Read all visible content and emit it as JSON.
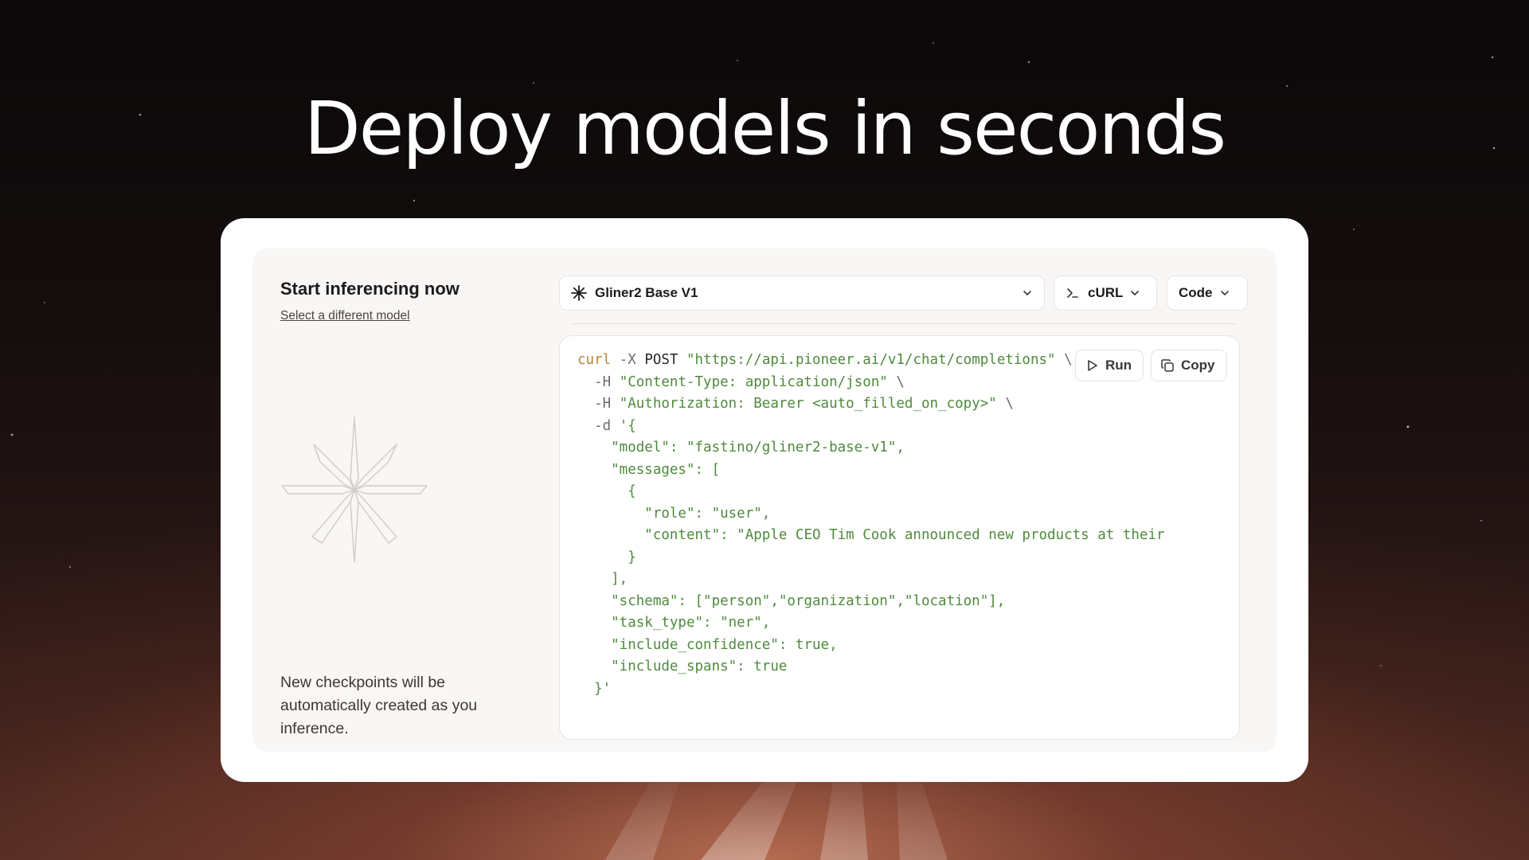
{
  "headline": "Deploy models in seconds",
  "left": {
    "title": "Start inferencing now",
    "link": "Select a different model",
    "note": "New checkpoints will be automatically created as you inference."
  },
  "toolbar": {
    "model_label": "Gliner2 Base V1",
    "language_label": "cURL",
    "view_label": "Code"
  },
  "actions": {
    "run_label": "Run",
    "copy_label": "Copy"
  },
  "code_lines": [
    [
      {
        "t": "kw",
        "v": "curl"
      },
      {
        "t": "dim",
        "v": " -X "
      },
      {
        "t": "plain",
        "v": "POST "
      },
      {
        "t": "str",
        "v": "\"https://api.pioneer.ai/v1/chat/completions\""
      },
      {
        "t": "dim",
        "v": " \\"
      }
    ],
    [
      {
        "t": "dim",
        "v": "  -H "
      },
      {
        "t": "str",
        "v": "\"Content-Type: application/json\""
      },
      {
        "t": "dim",
        "v": " \\"
      }
    ],
    [
      {
        "t": "dim",
        "v": "  -H "
      },
      {
        "t": "str",
        "v": "\"Authorization: Bearer <auto_filled_on_copy>\""
      },
      {
        "t": "dim",
        "v": " \\"
      }
    ],
    [
      {
        "t": "dim",
        "v": "  -d "
      },
      {
        "t": "str",
        "v": "'{"
      }
    ],
    [
      {
        "t": "str",
        "v": "    \"model\": \"fastino/gliner2-base-v1\","
      }
    ],
    [
      {
        "t": "str",
        "v": "    \"messages\": ["
      }
    ],
    [
      {
        "t": "str",
        "v": "      {"
      }
    ],
    [
      {
        "t": "str",
        "v": "        \"role\": \"user\","
      }
    ],
    [
      {
        "t": "str",
        "v": "        \"content\": \"Apple CEO Tim Cook announced new products at their"
      }
    ],
    [
      {
        "t": "str",
        "v": "      }"
      }
    ],
    [
      {
        "t": "str",
        "v": "    ],"
      }
    ],
    [
      {
        "t": "str",
        "v": "    \"schema\": [\"person\",\"organization\",\"location\"],"
      }
    ],
    [
      {
        "t": "str",
        "v": "    \"task_type\": \"ner\","
      }
    ],
    [
      {
        "t": "str",
        "v": "    \"include_confidence\": true,"
      }
    ],
    [
      {
        "t": "str",
        "v": "    \"include_spans\": true"
      }
    ],
    [
      {
        "t": "str",
        "v": "  }'"
      }
    ]
  ],
  "colors": {
    "keyword": "#b8863b",
    "string": "#4f8a3d",
    "card_bg": "#ffffff",
    "panel_bg": "#f8f7f6"
  },
  "icons": {
    "model": "sparkle-icon",
    "language": "terminal-icon",
    "run": "play-icon",
    "copy": "copy-icon",
    "dropdown": "chevron-down-icon",
    "brand": "star-logo-icon"
  }
}
